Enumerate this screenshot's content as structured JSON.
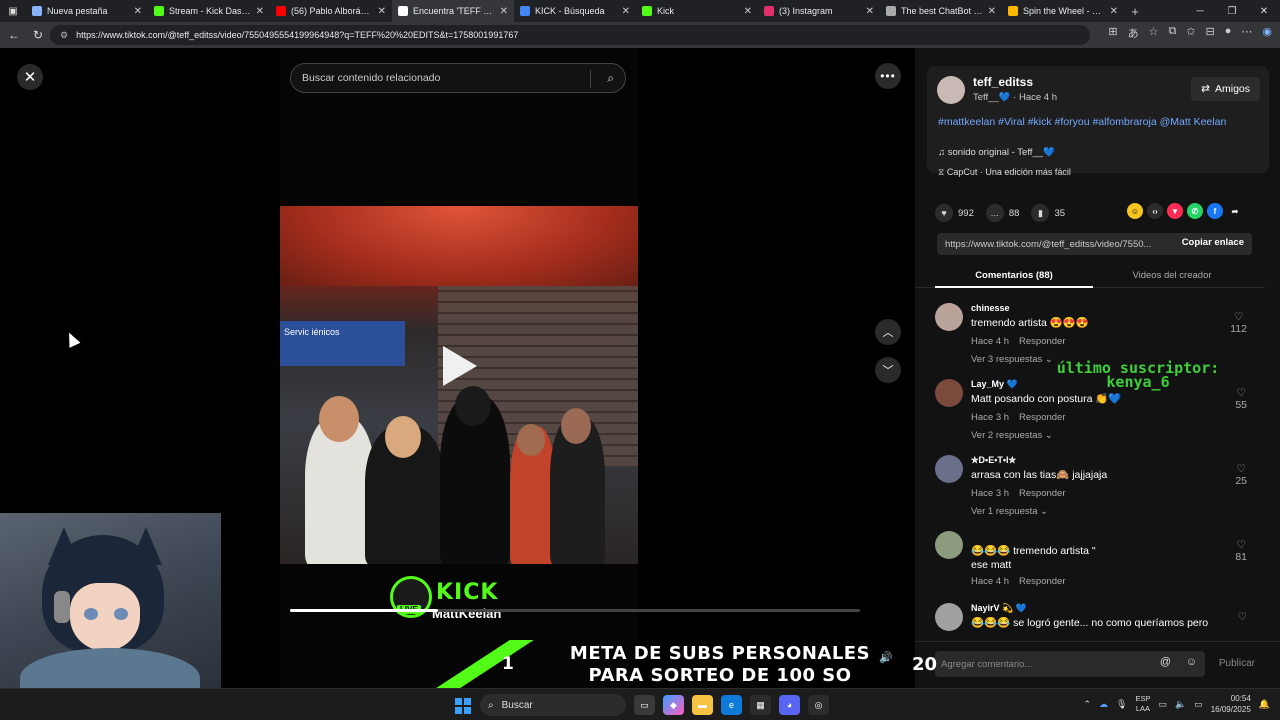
{
  "browser": {
    "tabs": [
      {
        "title": "Nueva pestaña",
        "fav": "newtab-icon",
        "color": "#8ab4f8"
      },
      {
        "title": "Stream - Kick Dashboard",
        "fav": "kick-icon",
        "color": "#53fc18"
      },
      {
        "title": "(56) Pablo Alborán - Sa",
        "fav": "youtube-icon",
        "color": "#ff0000"
      },
      {
        "title": "Encuentra 'TEFF EDITS",
        "fav": "tiktok-icon",
        "color": "#ffffff",
        "active": true
      },
      {
        "title": "KICK - Búsqueda",
        "fav": "search-icon",
        "color": "#4285f4"
      },
      {
        "title": "Kick",
        "fav": "kick-icon",
        "color": "#53fc18"
      },
      {
        "title": "(3) Instagram",
        "fav": "instagram-icon",
        "color": "#e1306c"
      },
      {
        "title": "The best ChatBot and I",
        "fav": "chatbot-icon",
        "color": "#aaaaaa"
      },
      {
        "title": "Spin the Wheel - Free",
        "fav": "wheel-icon",
        "color": "#ffb800"
      }
    ],
    "url": "https://www.tiktok.com/@teff_editss/video/7550495554199964948?q=TEFF%20%20EDITS&t=1758001991767"
  },
  "player": {
    "search_placeholder": "Buscar contenido relacionado",
    "kick_word": "KICK",
    "kick_live": "LIVE",
    "kick_channel": "MattKeelan",
    "sign_text": "Servic    iénicos",
    "progress": 0.26
  },
  "post": {
    "username": "teff_editss",
    "display": "Teff__💙 · Hace 4 h",
    "friends_label": "Amigos",
    "hashtags": "#mattkeelan #Viral #kick #foryou #alfombraroja @Matt Keelan",
    "sound": "sonido original - Teff__💙",
    "capcut": "CapCut · Una edición más fácil",
    "likes": "992",
    "comments": "88",
    "saves": "35",
    "link": "https://www.tiktok.com/@teff_editss/video/7550...",
    "copy_label": "Copiar enlace",
    "tab_comments": "Comentarios (88)",
    "tab_videos": "Videos del creador"
  },
  "comments": [
    {
      "user": "chinesse",
      "text": "tremendo artista 😍😍😍",
      "time": "Hace 4 h",
      "reply": "Responder",
      "more": "Ver 3 respuestas",
      "likes": "112",
      "avatar_color": "#b9a39a"
    },
    {
      "user": "Lay_My 💙",
      "text": "Matt posando con postura 👏💙",
      "time": "Hace 3 h",
      "reply": "Responder",
      "more": "Ver 2 respuestas",
      "likes": "55",
      "avatar_color": "#7a4a3d"
    },
    {
      "user": "✮D•E•T•I✮",
      "text": "arrasa con las tias🙈 jajjajaja",
      "time": "Hace 3 h",
      "reply": "Responder",
      "more": "Ver 1 respuesta",
      "likes": "25",
      "avatar_color": "#6a6f8a"
    },
    {
      "user": "",
      "text": "😂😂😂 tremendo artista \"",
      "text2": "ese matt",
      "time": "Hace 4 h",
      "reply": "Responder",
      "more": "",
      "likes": "81",
      "avatar_color": "#8c9a7d"
    },
    {
      "user": "NayirV 💫 💙",
      "text": "😂😂😂 se logró gente... no como queríamos pero",
      "time": "",
      "reply": "",
      "more": "",
      "likes": "",
      "avatar_color": "#a0a0a0"
    }
  ],
  "overlay": {
    "sub_title": "último suscriptor:",
    "sub_name": "kenya_6"
  },
  "comment_input": {
    "placeholder": "Agregar comentario...",
    "post_label": "Publicar"
  },
  "goal": {
    "current": "1",
    "line1": "META DE SUBS PERSONALES",
    "line2": "PARA SORTEO DE 100 SO",
    "total": "20",
    "accent": "#53fc18"
  },
  "taskbar": {
    "search_label": "Buscar",
    "lang1": "ESP",
    "lang2": "LAA",
    "time": "00:54",
    "date": "16/09/2025"
  }
}
